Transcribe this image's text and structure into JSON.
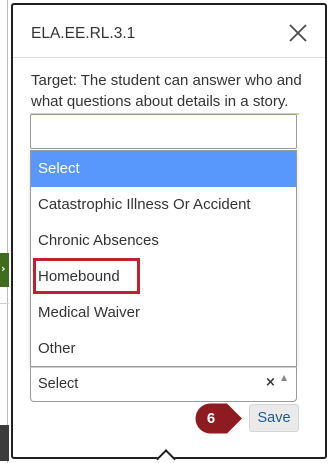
{
  "modal": {
    "title": "ELA.EE.RL.3.1",
    "target_text": "Target: The student can answer who and what questions about details in a story.",
    "text_input_value": ""
  },
  "dropdown": {
    "options": [
      "Select",
      "Catastrophic Illness Or Accident",
      "Chronic Absences",
      "Homebound",
      "Medical Waiver",
      "Other"
    ],
    "highlighted_option": "Select",
    "annotated_option": "Homebound",
    "selected_value": "Select"
  },
  "annotation": {
    "step_number": "6"
  },
  "footer": {
    "save_label": "Save"
  },
  "colors": {
    "highlight": "#5897fb",
    "callout": "#c0212c",
    "badge": "#8e1b1f",
    "link": "#1f5a95"
  },
  "icons": {
    "close": "close-icon",
    "clear": "clear-icon",
    "caret": "caret-up-icon"
  }
}
